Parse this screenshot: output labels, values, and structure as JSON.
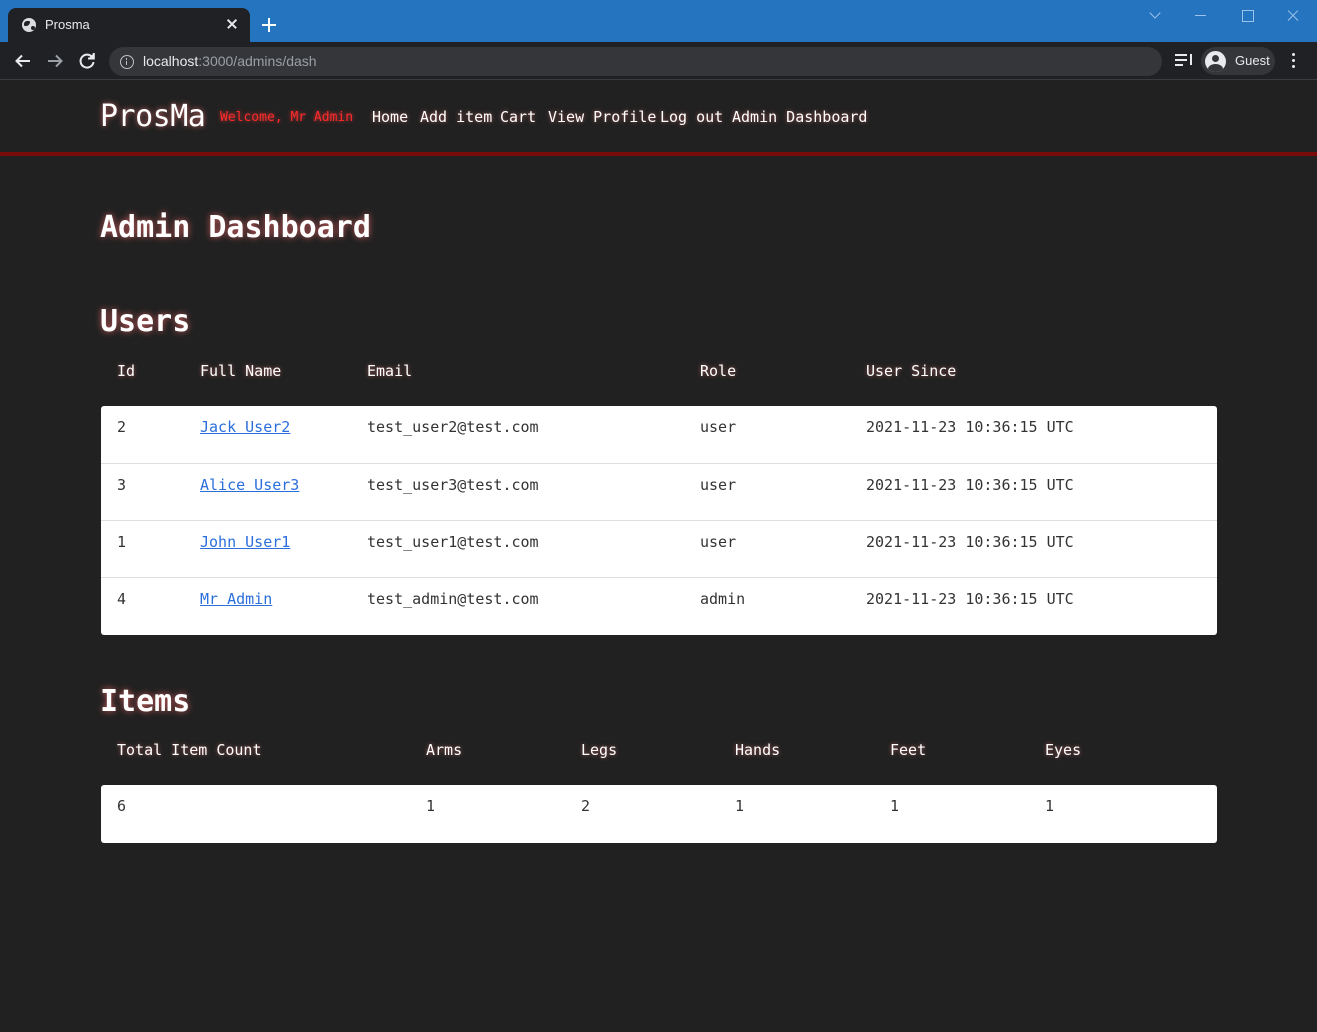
{
  "browser": {
    "tab_title": "Prosma",
    "url_host": "localhost",
    "url_path": ":3000/admins/dash",
    "profile_label": "Guest"
  },
  "nav": {
    "brand": "ProsMa",
    "welcome": "Welcome, Mr Admin",
    "links": [
      "Home",
      "Add item",
      "Cart",
      "View Profile",
      "Log out",
      "Admin Dashboard"
    ]
  },
  "page": {
    "title": "Admin Dashboard",
    "users_heading": "Users",
    "items_heading": "Items"
  },
  "users": {
    "columns": [
      "Id",
      "Full Name",
      "Email",
      "Role",
      "User Since"
    ],
    "rows": [
      {
        "id": "2",
        "name": "Jack User2",
        "email": "test_user2@test.com",
        "role": "user",
        "since": "2021-11-23 10:36:15 UTC"
      },
      {
        "id": "3",
        "name": "Alice User3",
        "email": "test_user3@test.com",
        "role": "user",
        "since": "2021-11-23 10:36:15 UTC"
      },
      {
        "id": "1",
        "name": "John User1",
        "email": "test_user1@test.com",
        "role": "user",
        "since": "2021-11-23 10:36:15 UTC"
      },
      {
        "id": "4",
        "name": "Mr Admin",
        "email": "test_admin@test.com",
        "role": "admin",
        "since": "2021-11-23 10:36:15 UTC"
      }
    ]
  },
  "items": {
    "columns": [
      "Total Item Count",
      "Arms",
      "Legs",
      "Hands",
      "Feet",
      "Eyes"
    ],
    "values": [
      "6",
      "1",
      "2",
      "1",
      "1",
      "1"
    ]
  }
}
